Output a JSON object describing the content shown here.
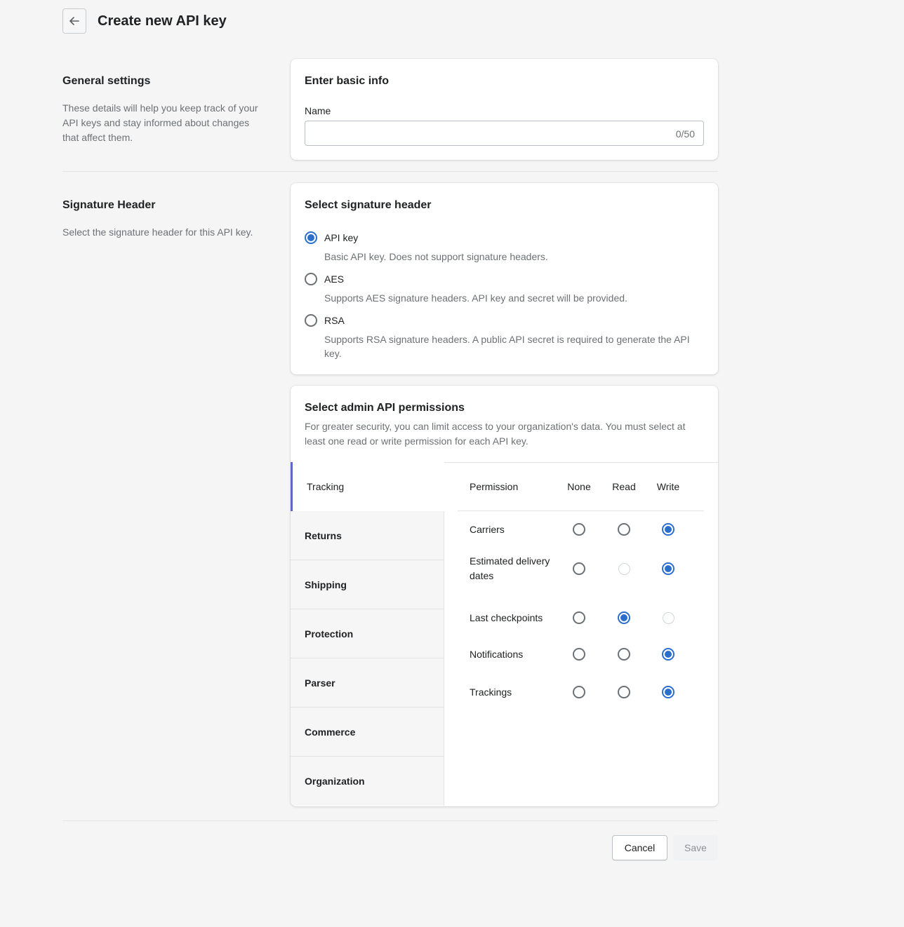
{
  "header": {
    "title": "Create new API key",
    "back_icon": "arrow-left-icon"
  },
  "general": {
    "title": "General settings",
    "description": "These details will help you keep track of your API keys and stay informed about changes that affect them.",
    "card_title": "Enter basic info",
    "name_label": "Name",
    "name_value": "",
    "name_counter": "0/50"
  },
  "signature": {
    "title": "Signature Header",
    "description": "Select the signature header for this API key.",
    "card_title": "Select signature header",
    "options": [
      {
        "label": "API key",
        "description": "Basic API key. Does not support signature headers.",
        "selected": true
      },
      {
        "label": "AES",
        "description": "Supports AES signature headers. API key and secret will be provided.",
        "selected": false
      },
      {
        "label": "RSA",
        "description": "Supports RSA signature headers. A public API secret is required to generate the API key.",
        "selected": false
      }
    ]
  },
  "permissions": {
    "card_title": "Select admin API permissions",
    "description": "For greater security, you can limit access to your organization's data. You must select at least one read or write permission for each API key.",
    "tabs": [
      "Tracking",
      "Returns",
      "Shipping",
      "Protection",
      "Parser",
      "Commerce",
      "Organization"
    ],
    "active_tab": "Tracking",
    "columns": {
      "permission": "Permission",
      "none": "None",
      "read": "Read",
      "write": "Write"
    },
    "rows": [
      {
        "name": "Carriers",
        "value": "write",
        "disabled": []
      },
      {
        "name": "Estimated delivery dates",
        "value": "write",
        "disabled": [
          "read"
        ]
      },
      {
        "name": "Last checkpoints",
        "value": "read",
        "disabled": [
          "write"
        ]
      },
      {
        "name": "Notifications",
        "value": "write",
        "disabled": []
      },
      {
        "name": "Trackings",
        "value": "write",
        "disabled": []
      }
    ]
  },
  "footer": {
    "cancel_label": "Cancel",
    "save_label": "Save"
  },
  "colors": {
    "accent": "#2c6ecb",
    "tab_indicator": "#5c6ac4",
    "background": "#f5f5f5"
  }
}
